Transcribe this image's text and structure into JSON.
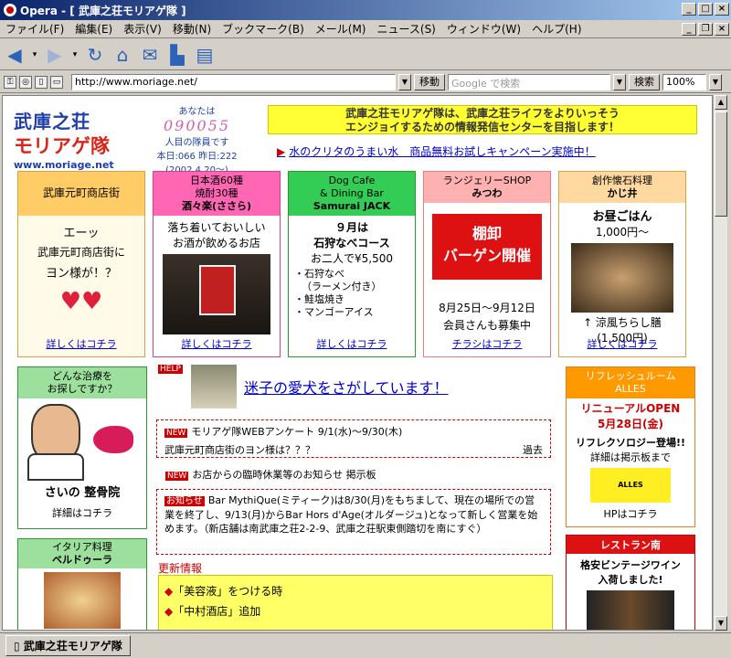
{
  "window": {
    "title": "Opera - [ 武庫之荘モリアゲ隊 ]"
  },
  "menu": [
    "ファイル(F)",
    "編集(E)",
    "表示(V)",
    "移動(N)",
    "ブックマーク(B)",
    "メール(M)",
    "ニュース(S)",
    "ウィンドウ(W)",
    "ヘルプ(H)"
  ],
  "address": {
    "url": "http://www.moriage.net/",
    "go_label": "移動",
    "search_placeholder": "Google で検索",
    "search_label": "検索",
    "zoom": "100%"
  },
  "status_tab": "武庫之荘モリアゲ隊",
  "site": {
    "logo_line1": "武庫之荘",
    "logo_line2": "モリアゲ隊",
    "logo_url": "www.moriage.net",
    "counter_label": "あなたは",
    "counter_digits": "090055",
    "counter_suffix": "人目の隊員です",
    "counter_today": "本日:066 昨日:222",
    "counter_date": "(2002.4.20〜)",
    "banner_line1": "武庫之荘モリアゲ隊は、武庫之荘ライフをよりいっそう",
    "banner_line2": "エンジョイするための情報発信センターを目指します！",
    "campaign": "水のクリタのうまい水　商品無料お試しキャンペーン実施中！"
  },
  "cards": [
    {
      "head": "武庫元町商店街",
      "body1": "エーッ",
      "body2": "武庫元町商店街に",
      "body3": "ヨン様が！？",
      "link": "詳しくはコチラ"
    },
    {
      "head1": "日本酒60種",
      "head2": "焼酎30種",
      "head3": "酒々楽(ささら)",
      "body1": "落ち着いておいしい",
      "body2": "お酒が飲めるお店",
      "link": "詳しくはコチラ"
    },
    {
      "head1": "Dog Cafe",
      "head2": "& Dining Bar",
      "head3": "Samurai JACK",
      "body1": "９月は",
      "body2": "石狩なべコース",
      "body3": "お二人で¥5,500",
      "list": [
        "・石狩なべ",
        "（ラーメン付き）",
        "・鮭塩焼き",
        "・マンゴーアイス"
      ],
      "link": "詳しくはコチラ"
    },
    {
      "head1": "ランジェリーSHOP",
      "head2": "みつわ",
      "sale1": "棚卸",
      "sale2": "バーゲン開催",
      "body1": "8月25日〜9月12日",
      "body2": "会員さんも募集中",
      "link": "チラシはコチラ"
    },
    {
      "head1": "創作懐石料理",
      "head2": "かじ井",
      "body1": "お昼ごはん",
      "body2": "1,000円〜",
      "body3": "↑ 涼風ちらし膳",
      "body4": "(1,500円)",
      "link": "詳しくはコチラ"
    }
  ],
  "left": {
    "seitai_head1": "どんな治療を",
    "seitai_head2": "お探しですか？",
    "seitai_name": "さいの 整骨院",
    "seitai_link": "詳細はコチラ",
    "italian_head1": "イタリア料理",
    "italian_head2": "ベルドゥーラ"
  },
  "middle": {
    "help_tag": "HELP",
    "lost_dog": "迷子の愛犬をさがしています！",
    "new_tag": "NEW",
    "survey": "モリアゲ隊WEBアンケート",
    "survey_date": "9/1(水)〜9/30(木)",
    "yon_topic": "武庫元町商店街のヨン様は？？？",
    "past": "過去",
    "closure": "お店からの臨時休業等のお知らせ 掲示板",
    "notice_tag": "お知らせ",
    "notice_body": "Bar MythiQue(ミティーク)は8/30(月)をもちまして、現在の場所での営業を終了し、9/13(月)からBar Hors d'Age(オルダージュ)となって新しく営業を始めます。（新店舗は南武庫之荘2-2-9、武庫之荘駅東側踏切を南にすぐ）",
    "update_title": "更新情報",
    "updates": [
      "「美容液」をつける時",
      "「中村酒店」追加"
    ]
  },
  "right": {
    "alles_head1": "リフレッシュルーム",
    "alles_head2": "ALLES",
    "alles_open": "リニューアルOPEN",
    "alles_date": "5月28日(金)",
    "alles_body": "リフレクソロジー登場!!",
    "alles_link1": "詳細は掲示板まで",
    "alles_logo": "ALLES",
    "alles_link2": "HPはコチラ",
    "rest_head": "レストラン南",
    "rest_body1": "格安ビンテージワイン",
    "rest_body2": "入荷しました!"
  }
}
